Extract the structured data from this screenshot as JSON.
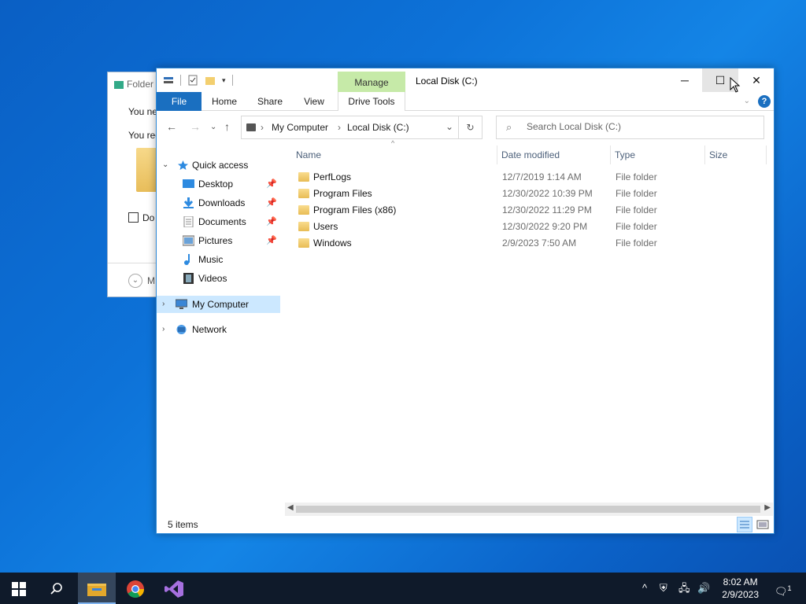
{
  "background_dialog": {
    "title": "Folder",
    "line1": "You ne",
    "line2": "You rec",
    "checkbox_label": "Do",
    "more_label": "M"
  },
  "window": {
    "title": "Local Disk (C:)",
    "manage_label": "Manage",
    "controls": {
      "minimize": "─",
      "maximize": "☐",
      "close": "✕"
    }
  },
  "ribbon": {
    "tabs": [
      "File",
      "Home",
      "Share",
      "View",
      "Drive Tools"
    ]
  },
  "address": {
    "crumbs": [
      "My Computer",
      "Local Disk (C:)"
    ],
    "search_placeholder": "Search Local Disk (C:)"
  },
  "nav": {
    "quick_access": "Quick access",
    "items": [
      {
        "label": "Desktop",
        "icon": "desktop-icon",
        "pinned": true
      },
      {
        "label": "Downloads",
        "icon": "downloads-icon",
        "pinned": true
      },
      {
        "label": "Documents",
        "icon": "documents-icon",
        "pinned": true
      },
      {
        "label": "Pictures",
        "icon": "pictures-icon",
        "pinned": true
      },
      {
        "label": "Music",
        "icon": "music-icon",
        "pinned": false
      },
      {
        "label": "Videos",
        "icon": "videos-icon",
        "pinned": false
      }
    ],
    "my_computer": "My Computer",
    "network": "Network"
  },
  "columns": {
    "name": "Name",
    "date": "Date modified",
    "type": "Type",
    "size": "Size"
  },
  "files": [
    {
      "name": "PerfLogs",
      "date": "12/7/2019 1:14 AM",
      "type": "File folder"
    },
    {
      "name": "Program Files",
      "date": "12/30/2022 10:39 PM",
      "type": "File folder"
    },
    {
      "name": "Program Files (x86)",
      "date": "12/30/2022 11:29 PM",
      "type": "File folder"
    },
    {
      "name": "Users",
      "date": "12/30/2022 9:20 PM",
      "type": "File folder"
    },
    {
      "name": "Windows",
      "date": "2/9/2023 7:50 AM",
      "type": "File folder"
    }
  ],
  "status": {
    "items_count": "5 items"
  },
  "taskbar": {
    "time": "8:02 AM",
    "date": "2/9/2023",
    "notification_count": "1"
  },
  "colors": {
    "accent": "#1a6fc0",
    "manage_tab": "#c6eaa8",
    "selection": "#cce8ff",
    "taskbar": "#0f1a2a"
  }
}
